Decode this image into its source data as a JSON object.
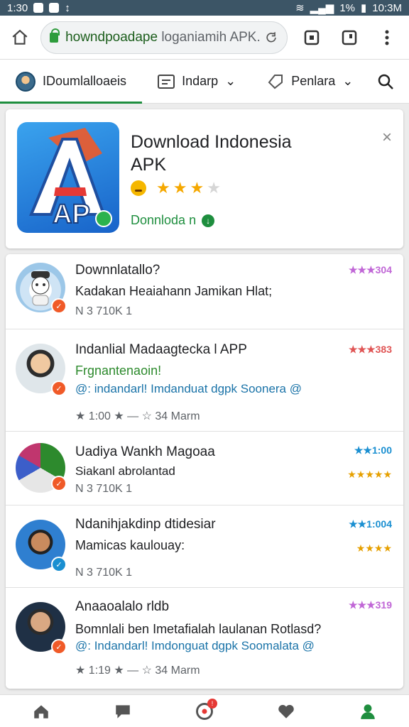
{
  "status_bar": {
    "time_left": "1:30",
    "carrier": "1:30",
    "battery_pct": "1%",
    "time_right": "10:3M"
  },
  "browser": {
    "url_domain": "howndpoadape",
    "url_rest": " loganiamih APK."
  },
  "tabs": [
    {
      "label": "IDoumlalloaeis"
    },
    {
      "label": "Indarp"
    },
    {
      "label": "Penlara"
    }
  ],
  "hero": {
    "title_line1": "Download Indonesia",
    "title_line2": "APK",
    "download_label": "Donnloda n",
    "close_glyph": "×",
    "rating": 3,
    "rating_max": 4
  },
  "list_items": [
    {
      "title": "Downnlatallo?",
      "line1": "Kadakan Heaiahann Jamikan Hlat;",
      "line2": "",
      "meta": "N 3 710K 1",
      "rank": "★★★304",
      "rank_color": "#c066d6",
      "badge_color": "#f05a28"
    },
    {
      "title": "Indanlial Madaagtecka l APP",
      "line1": "Frgnantenaoin!",
      "line2": "@: indandarl! Imdanduat dgpk Soonera @",
      "meta": "★ 1:00 ★     —     ☆ 34 Marm",
      "rank": "★★★383",
      "rank_color": "#e05555",
      "badge_color": "#f05a28"
    },
    {
      "title": "Uadiya Wankh Magoaa",
      "line1": "Siakanl abrolantad",
      "line2": "",
      "meta": "N 3 710K 1",
      "rank": "★★1:00",
      "rank_color": "#1a8fd1",
      "rank2": "★★★★★",
      "badge_color": "#f05a28"
    },
    {
      "title": "Ndanihjakdinp dtidesiar",
      "line1": "Mamicas kaulouay:",
      "line2": "",
      "meta": "N 3 710K 1",
      "rank": "★★1:004",
      "rank_color": "#1a8fd1",
      "rank2": "★★★★",
      "badge_color": "#1a8fd1"
    },
    {
      "title": "Anaaoalalo rldb",
      "line1": "Bomnlali ben Imetafialah laulanan Rotlasd?",
      "line2": "@: Indandarl! Imdonguat dgpk Soomalata @",
      "meta": "★ 1:19 ★     —     ☆ 34 Marm",
      "rank": "★★★319",
      "rank_color": "#c066d6",
      "badge_color": "#f05a28"
    }
  ]
}
